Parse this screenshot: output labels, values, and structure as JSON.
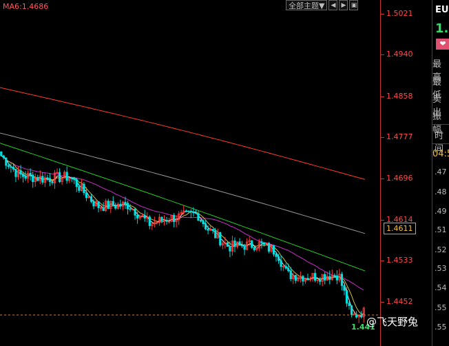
{
  "header": {
    "ma_label": "MA6:1.4686",
    "theme_button": "全部主题▼",
    "icon_buttons": [
      "◀",
      "▶",
      "▣"
    ]
  },
  "axis": {
    "ticks": [
      "1.5021",
      "1.4940",
      "1.4858",
      "1.4777",
      "1.4696",
      "1.4614",
      "1.4533",
      "1.4452"
    ],
    "current_price": "1.4611",
    "last_price": "1.441"
  },
  "watermark": "@飞天野兔",
  "side_panel": {
    "symbol": "EU",
    "price": "1.",
    "stats_labels": [
      "最高",
      "最低",
      "卖出",
      "振幅"
    ],
    "time_header": "时间",
    "time_value": "04:5",
    "quotes": [
      ".47",
      ".48",
      ".49",
      ".51",
      ".52",
      ".53",
      ".54",
      ".55"
    ]
  },
  "colors": {
    "up": "#ff3b3b",
    "down": "#00e0e0",
    "ma_red": "#ff3b2f",
    "ma_gray": "#9a9a9a",
    "ma_green": "#22cc22",
    "ma_magenta": "#dd33dd",
    "ma_white": "#ffffff",
    "ma_yellow": "#e8d44a",
    "price_green": "#33dd66"
  },
  "chart_data": {
    "type": "candlestick",
    "ylim": [
      1.44,
      1.505
    ],
    "y_ticks": [
      1.5021,
      1.494,
      1.4858,
      1.4777,
      1.4696,
      1.4614,
      1.4533,
      1.4452
    ],
    "current_price": 1.4611,
    "moving_averages": [
      {
        "name": "MA6",
        "value": 1.4686
      }
    ],
    "ma_lines_start_end": [
      {
        "color": "red",
        "start": 1.4875,
        "end": 1.4693
      },
      {
        "color": "gray",
        "start": 1.4785,
        "end": 1.4586
      },
      {
        "color": "green",
        "start": 1.4765,
        "end": 1.4512
      },
      {
        "color": "magenta",
        "start": 1.472,
        "end": 1.4475
      }
    ],
    "price_start": 1.474,
    "price_end": 1.442
  }
}
